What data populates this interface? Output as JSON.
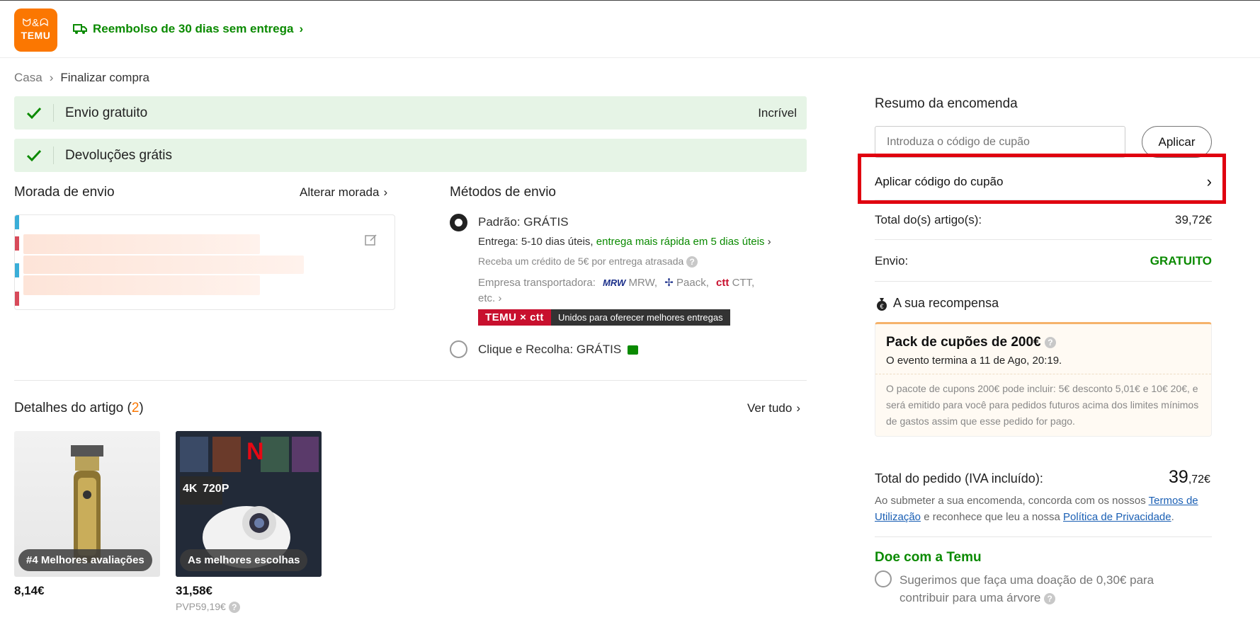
{
  "header": {
    "logo_glyphs": "ጿ&#x2042;",
    "logo_text": "TEMU",
    "refund_text": "Reembolso de 30 dias sem entrega",
    "refund_chevron": "›"
  },
  "breadcrumb": {
    "home": "Casa",
    "sep": "›",
    "current": "Finalizar compra"
  },
  "banners": [
    {
      "label": "Envio gratuito",
      "right": "Incrível"
    },
    {
      "label": "Devoluções grátis",
      "right": ""
    }
  ],
  "address": {
    "title": "Morada de envio",
    "change_link": "Alterar morada",
    "chevron": "›"
  },
  "shipping": {
    "title": "Métodos de envio",
    "standard_label": "Padrão: GRÁTIS",
    "delivery_prefix": "Entrega: 5-10 dias úteis,",
    "delivery_fast": "entrega mais rápida em 5 dias úteis",
    "credit_note": "Receba um crédito de 5€ por entrega atrasada",
    "carrier_prefix": "Empresa transportadora:",
    "carrier_mrw_logo": "MRW",
    "carrier_mrw": "MRW,",
    "carrier_paack": "Paack,",
    "carrier_ctt_logo": "ctt",
    "carrier_ctt": "CTT,",
    "carrier_etc": "etc.",
    "ctt_badge": "TEMU × ctt",
    "ctt_badge_text": "Unidos para oferecer melhores entregas",
    "pickup_label": "Clique e Recolha: GRÁTIS"
  },
  "items": {
    "title_prefix": "Detalhes do artigo (",
    "count": "2",
    "title_suffix": ")",
    "see_all": "Ver tudo",
    "products": [
      {
        "badge": "#4 Melhores avaliações",
        "price": "8,14€"
      },
      {
        "badge": "As melhores escolhas",
        "price": "31,58€",
        "rrp": "PVP59,19€",
        "screen_labels": [
          "4K",
          "720P"
        ]
      }
    ]
  },
  "summary": {
    "title": "Resumo da encomenda",
    "coupon_placeholder": "Introduza o código de cupão",
    "apply_button": "Aplicar",
    "apply_coupon_row": "Aplicar código do cupão",
    "items_total_label": "Total do(s) artigo(s):",
    "items_total_value": "39,72€",
    "shipping_label": "Envio:",
    "shipping_value": "GRATUITO",
    "reward_title": "A sua recompensa",
    "reward_pack_title": "Pack de cupões de 200€",
    "reward_ends": "O evento termina a 11 de Ago, 20:19.",
    "reward_desc": "O pacote de cupons 200€ pode incluir: 5€ desconto 5,01€ e 10€ 20€, e será emitido para você para pedidos futuros acima dos limites mínimos de gastos assim que esse pedido for pago.",
    "order_total_label": "Total do pedido (IVA incluído):",
    "order_total_int": "39",
    "order_total_dec": ",72€",
    "terms_prefix": "Ao submeter a sua encomenda, concorda com os nossos",
    "terms_link": "Termos de Utilização",
    "terms_middle": "e reconhece que leu a nossa",
    "privacy_link": "Política de Privacidade",
    "terms_end": ".",
    "donate_title": "Doe com a Temu",
    "donate_text": "Sugerimos que faça uma doação de 0,30€ para contribuir para uma árvore"
  },
  "colors": {
    "brand": "#fb7701",
    "green": "#0a8a00",
    "highlight": "#e0000f",
    "banner_bg": "#e6f4e6"
  }
}
